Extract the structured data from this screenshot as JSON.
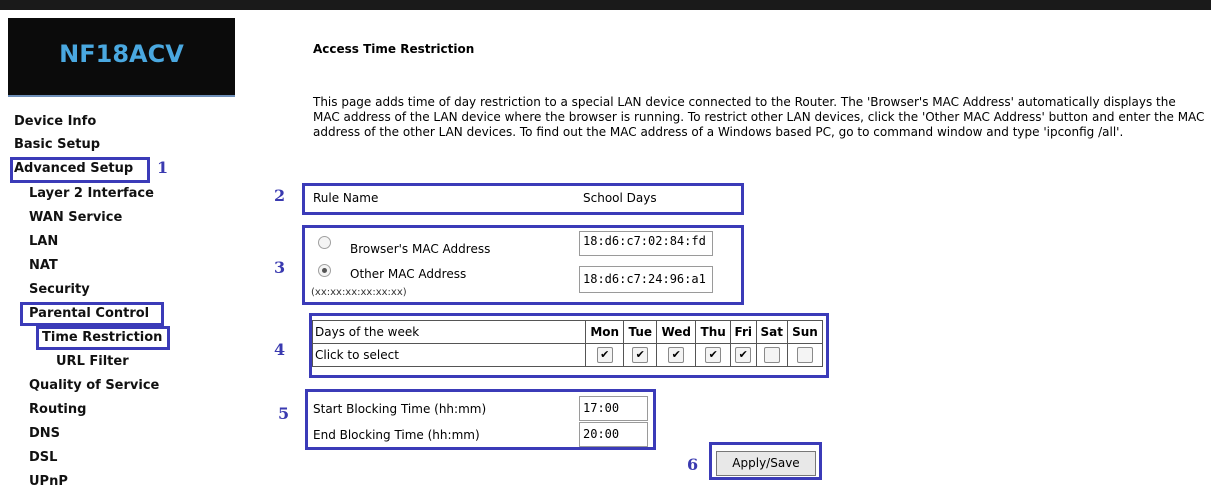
{
  "brand": "NF18ACV",
  "sidebar": {
    "items": [
      {
        "label": "Device Info"
      },
      {
        "label": "Basic Setup"
      },
      {
        "label": "Advanced Setup"
      },
      {
        "label": "Layer 2 Interface"
      },
      {
        "label": "WAN Service"
      },
      {
        "label": "LAN"
      },
      {
        "label": "NAT"
      },
      {
        "label": "Security"
      },
      {
        "label": "Parental Control"
      },
      {
        "label": "Time Restriction"
      },
      {
        "label": "URL Filter"
      },
      {
        "label": "Quality of Service"
      },
      {
        "label": "Routing"
      },
      {
        "label": "DNS"
      },
      {
        "label": "DSL"
      },
      {
        "label": "UPnP"
      }
    ]
  },
  "page": {
    "title": "Access Time Restriction",
    "description": "This page adds time of day restriction to a special LAN device connected to the Router. The 'Browser's MAC Address' automatically displays the MAC address of the LAN device where the browser is running. To restrict other LAN devices, click the 'Other MAC Address' button and enter the MAC address of the other LAN devices. To find out the MAC address of a Windows based PC, go to command window and type 'ipconfig /all'."
  },
  "callouts": [
    "1",
    "2",
    "3",
    "4",
    "5",
    "6"
  ],
  "form": {
    "rule_name_label": "Rule Name",
    "rule_name_value": "School Days",
    "browser_mac_label": "Browser's MAC Address",
    "browser_mac_value": "18:d6:c7:02:84:fd",
    "other_mac_label": "Other MAC Address",
    "other_mac_hint": "(xx:xx:xx:xx:xx:xx)",
    "other_mac_value": "18:d6:c7:24:96:a1",
    "selected_mac_option": "other",
    "days_label": "Days of the week",
    "click_label": "Click to select",
    "days": [
      {
        "label": "Mon",
        "checked": true
      },
      {
        "label": "Tue",
        "checked": true
      },
      {
        "label": "Wed",
        "checked": true
      },
      {
        "label": "Thu",
        "checked": true
      },
      {
        "label": "Fri",
        "checked": true
      },
      {
        "label": "Sat",
        "checked": false
      },
      {
        "label": "Sun",
        "checked": false
      }
    ],
    "start_label": "Start Blocking Time (hh:mm)",
    "start_value": "17:00",
    "end_label": "End Blocking Time (hh:mm)",
    "end_value": "20:00",
    "apply_label": "Apply/Save"
  },
  "colors": {
    "callout": "#3b3bb8",
    "brand_text": "#4aa8e0",
    "brand_bg": "#0b0b0b"
  }
}
